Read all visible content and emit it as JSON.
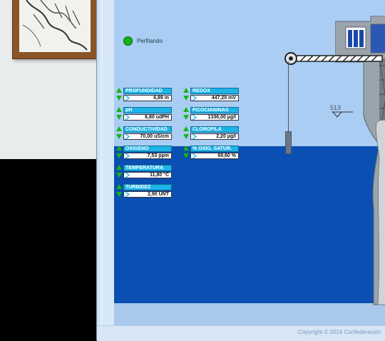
{
  "status": {
    "label": "Perfilando",
    "color": "#13b313"
  },
  "sensors": [
    {
      "name": "PROFUNDIDAD",
      "value": "6,89 m"
    },
    {
      "name": "pH",
      "value": "6,80 udPH"
    },
    {
      "name": "CONDUCTIVIDAD",
      "value": "70,00 uS/cm"
    },
    {
      "name": "OXIGENO",
      "value": "7,53 ppm"
    },
    {
      "name": "TEMPERATURA",
      "value": "11,80 °C"
    },
    {
      "name": "TURBIDEZ",
      "value": "2,90 UNT"
    },
    {
      "name": "REDOX",
      "value": "447,20 mV"
    },
    {
      "name": "FICOCIANINAS",
      "value": "1336,00 µg/l"
    },
    {
      "name": "CLOROFILA",
      "value": "2,20 µg/l"
    },
    {
      "name": "% OXIG. SATUR.",
      "value": "69,60 %"
    }
  ],
  "scene": {
    "water_level_label": "513"
  },
  "footer": {
    "copyright": "Copyright © 2014 Confederación"
  },
  "icons": [
    "status-dot-icon",
    "arrow-up-icon",
    "arrow-down-icon",
    "value-indicator-icon",
    "water-level-icon",
    "winch-icon"
  ]
}
